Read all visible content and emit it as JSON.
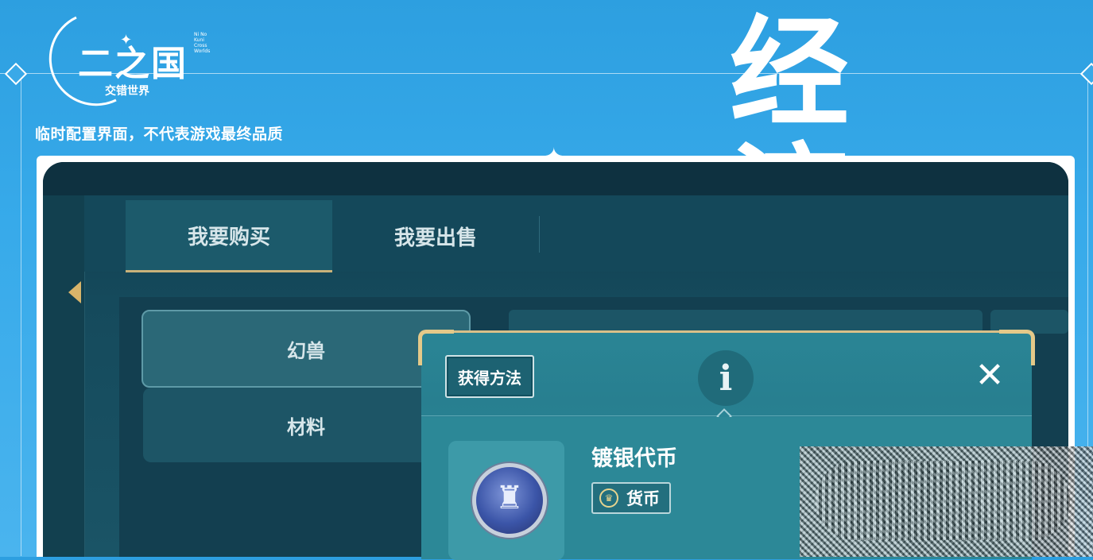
{
  "logo": {
    "main": "二之国",
    "sub": "交错世界",
    "en": "Ni No Kuni Cross Worlds"
  },
  "disclaimer": "临时配置界面，不代表游戏最终品质",
  "title": "经济",
  "tabs": [
    {
      "label": "我要购买",
      "active": true
    },
    {
      "label": "我要出售",
      "active": false
    }
  ],
  "categories": [
    {
      "label": "幻兽",
      "active": true
    },
    {
      "label": "材料",
      "active": false
    }
  ],
  "popup": {
    "acquire_label": "获得方法",
    "info_icon": "i",
    "close_icon": "✕",
    "item_name": "镀银代币",
    "item_tag": "货币"
  },
  "colors": {
    "background": "#37aaea",
    "game_bg": "#154a5c",
    "popup_bg": "#2a8595",
    "gold_accent": "#d9c088"
  }
}
